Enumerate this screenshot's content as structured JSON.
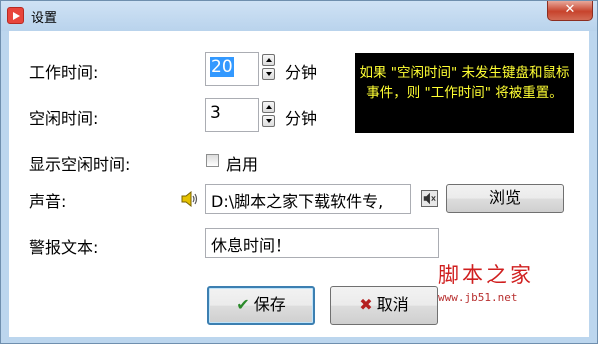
{
  "window": {
    "title": "设置",
    "close_label": "✕"
  },
  "work_time": {
    "label": "工作时间:",
    "value": "20",
    "unit": "分钟"
  },
  "idle_time": {
    "label": "空闲时间:",
    "value": "3",
    "unit": "分钟"
  },
  "hint": {
    "text": "如果 \"空闲时间\" 未发生键盘和鼠标事件，则 \"工作时间\" 将被重置。"
  },
  "show_idle": {
    "label": "显示空闲时间:",
    "checkbox_label": "启用",
    "checked": false
  },
  "sound": {
    "label": "声音:",
    "path": "D:\\脚本之家下载软件专,",
    "browse_label": "浏览"
  },
  "alert_text": {
    "label": "警报文本:",
    "value": "休息时间！"
  },
  "buttons": {
    "save_label": "保存",
    "save_icon": "✔",
    "cancel_label": "取消",
    "cancel_icon": "✖"
  },
  "watermark": {
    "title": "脚本之家",
    "url": "www.jb51.net"
  },
  "colors": {
    "hint_bg": "#000000",
    "hint_text": "#ffff33",
    "selection": "#3399ff",
    "watermark": "#d01f1f"
  }
}
